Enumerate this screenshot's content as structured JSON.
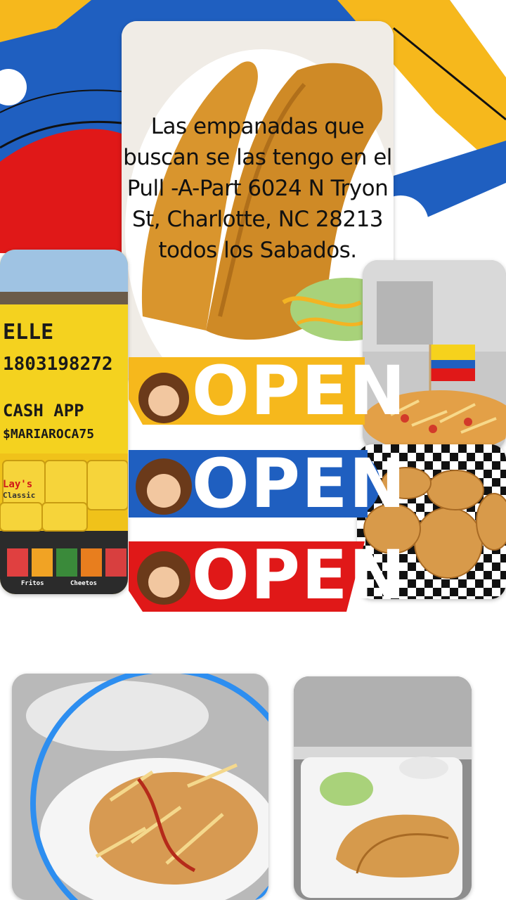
{
  "caption": "Las empanadas que buscan se las tengo en el Pull -A-Part 6024 N Tryon St, Charlotte, NC 28213 todos los Sabados.",
  "sign": {
    "line1": "ELLE",
    "line2": "1803198272",
    "line3": "CASH APP",
    "line4": "$MARIAROCA75"
  },
  "banners": [
    {
      "label": "OPEN",
      "color": "#f6b81c"
    },
    {
      "label": "OPEN",
      "color": "#1f5fc0"
    },
    {
      "label": "OPEN",
      "color": "#e01818"
    }
  ],
  "chip_brands": [
    "Lay's",
    "Classic",
    "Fritos",
    "Cheetos"
  ],
  "colors": {
    "yellow": "#f6b81c",
    "blue": "#1f5fc0",
    "red": "#e01818"
  }
}
